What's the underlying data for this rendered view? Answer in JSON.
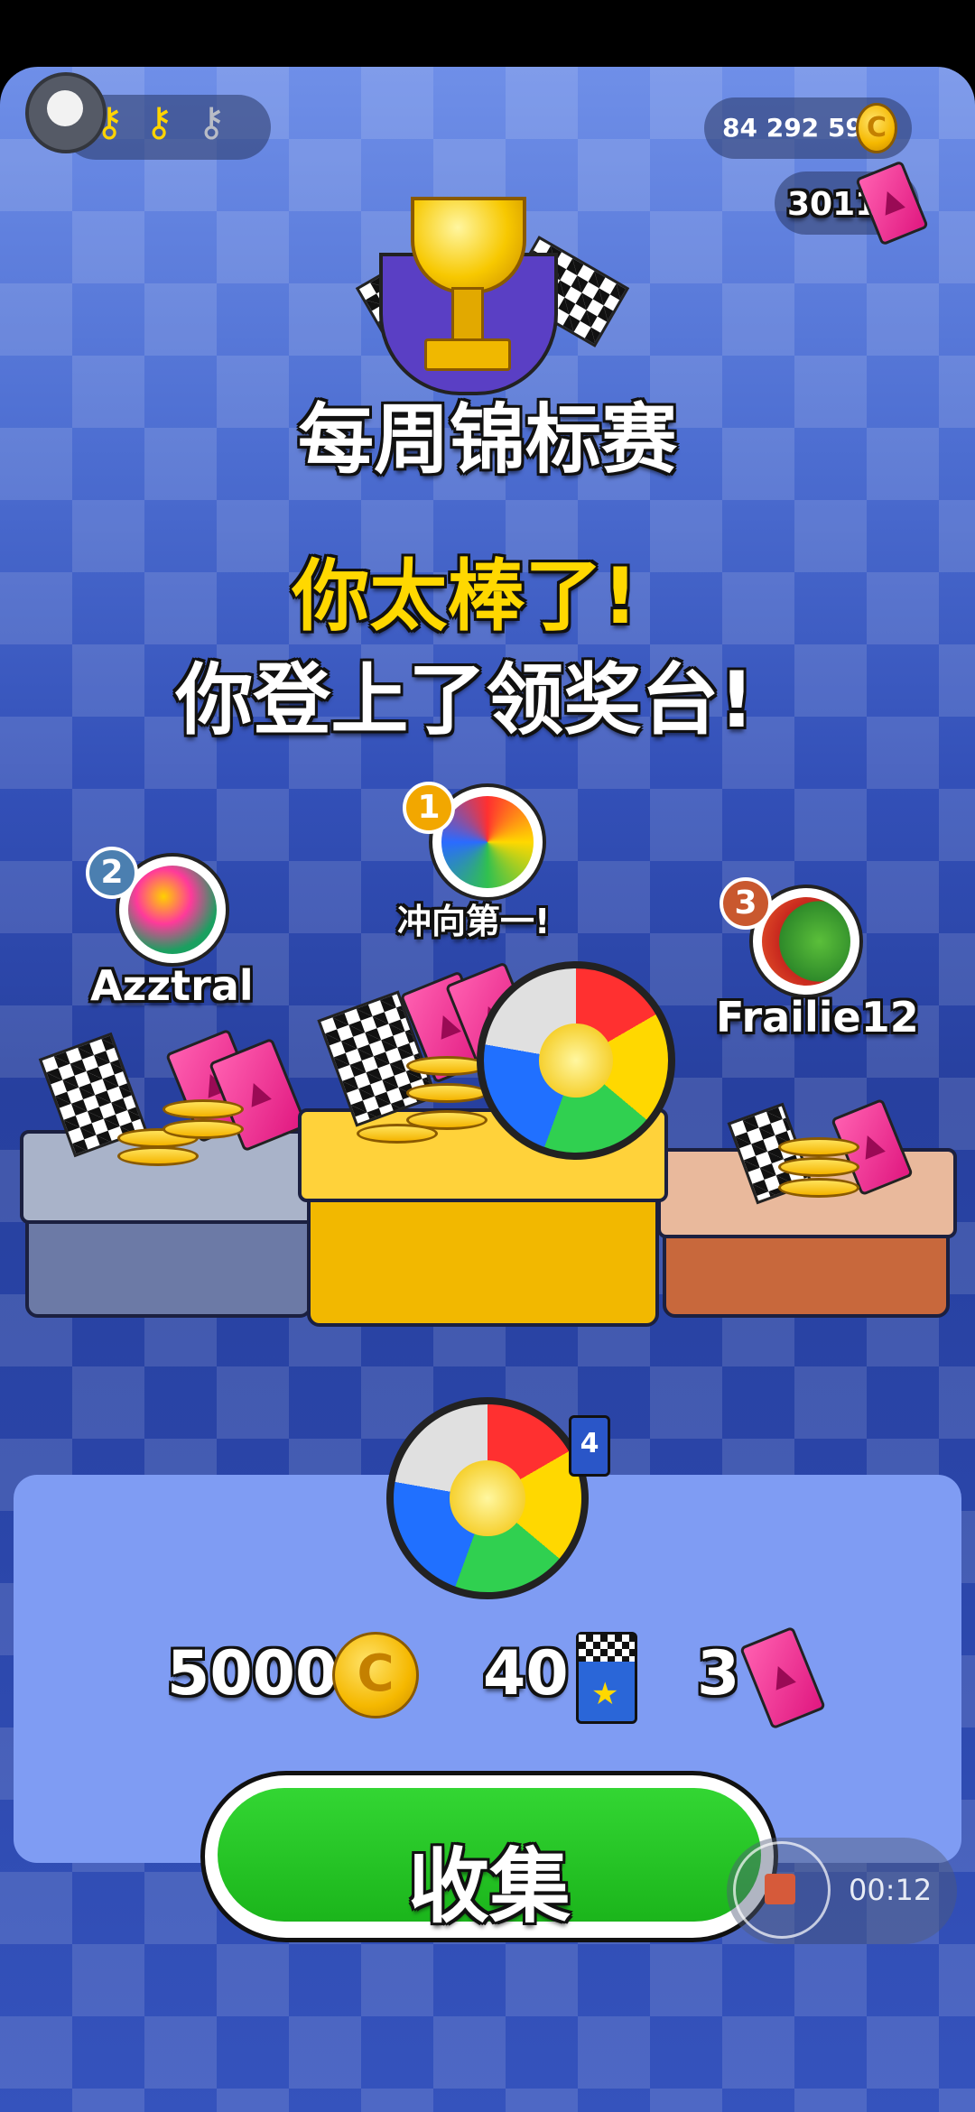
{
  "hud": {
    "keys": [
      {
        "icon": "gold-key-icon",
        "state": "collected"
      },
      {
        "icon": "gold-key-icon",
        "state": "collected"
      },
      {
        "icon": "grey-key-icon",
        "state": "empty"
      }
    ],
    "coins": "84 292 592",
    "tickets": "3011"
  },
  "title": "每周锦标赛",
  "headline_1": "你太棒了!",
  "headline_2": "你登上了领奖台!",
  "podium": {
    "first": {
      "rank": "1",
      "label": "冲向第一!"
    },
    "second": {
      "rank": "2",
      "name": "Azztral"
    },
    "third": {
      "rank": "3",
      "name": "Frailie12"
    }
  },
  "rewards": {
    "ball_number": "4",
    "coins": "5000",
    "flags": "40",
    "tickets": "3"
  },
  "collect_label": "收集",
  "recorder": {
    "time": "00:12"
  },
  "colors": {
    "accent_yellow": "#ffd800",
    "button_green": "#22c422",
    "panel": "#7f9cf3"
  }
}
